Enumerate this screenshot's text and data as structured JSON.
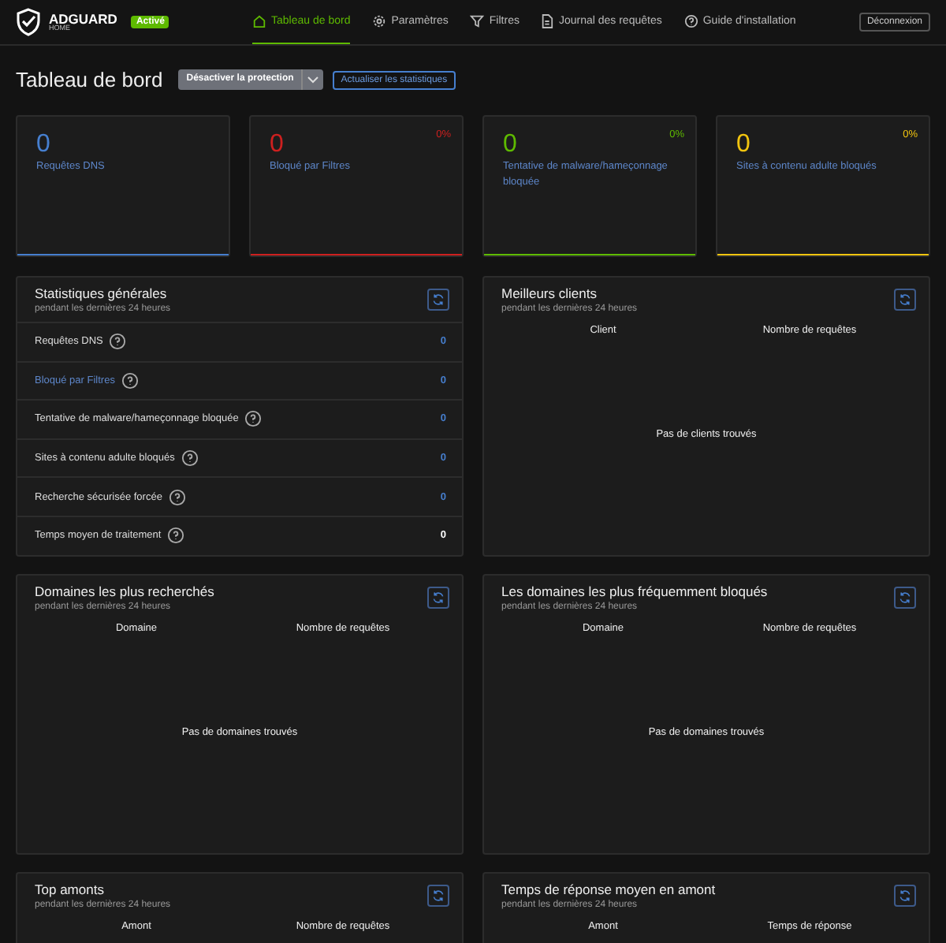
{
  "header": {
    "logo_title": "ADGUARD",
    "logo_subtitle": "HOME",
    "status_badge": "Activé",
    "nav": [
      {
        "label": "Tableau de bord",
        "kind": "home",
        "selected": true
      },
      {
        "label": "Paramètres",
        "kind": "settings",
        "selected": false
      },
      {
        "label": "Filtres",
        "kind": "filters",
        "selected": false
      },
      {
        "label": "Journal des requêtes",
        "kind": "log",
        "selected": false
      },
      {
        "label": "Guide d'installation",
        "kind": "guide",
        "selected": false
      }
    ],
    "logout_button": "Déconnexion"
  },
  "page": {
    "title": "Tableau de bord",
    "protection_button": "Désactiver la protection",
    "refresh_button": "Actualiser les statistiques"
  },
  "stat_cards": [
    {
      "value": "0",
      "label": "Requêtes DNS",
      "color": "#467fcf"
    },
    {
      "value": "0",
      "label": "Bloqué par Filtres",
      "percent": "0%",
      "color": "#cd201f"
    },
    {
      "value": "0",
      "label": "Tentative de malware/hameçonnage bloquée",
      "percent": "0%",
      "color": "#5eba00"
    },
    {
      "value": "0",
      "label": "Sites à contenu adulte bloqués",
      "percent": "0%",
      "color": "#f1c40f"
    }
  ],
  "general_stats": {
    "title": "Statistiques générales",
    "subtitle": "pendant les dernières 24 heures",
    "rows": [
      {
        "label": "Requêtes DNS",
        "value": "0",
        "label_link": false,
        "value_link": true
      },
      {
        "label": "Bloqué par Filtres",
        "value": "0",
        "label_link": true,
        "value_link": true
      },
      {
        "label": "Tentative de malware/hameçonnage bloquée",
        "value": "0",
        "label_link": false,
        "value_link": true
      },
      {
        "label": "Sites à contenu adulte bloqués",
        "value": "0",
        "label_link": false,
        "value_link": true
      },
      {
        "label": "Recherche sécurisée forcée",
        "value": "0",
        "label_link": false,
        "value_link": true
      },
      {
        "label": "Temps moyen de traitement",
        "value": "0",
        "label_link": false,
        "value_link": false
      }
    ]
  },
  "tables": [
    {
      "title": "Meilleurs clients",
      "subtitle": "pendant les dernières 24 heures",
      "columns": [
        "Client",
        "Nombre de requêtes"
      ],
      "empty_message": "Pas de clients trouvés"
    },
    {
      "title": "Domaines les plus recherchés",
      "subtitle": "pendant les dernières 24 heures",
      "columns": [
        "Domaine",
        "Nombre de requêtes"
      ],
      "empty_message": "Pas de domaines trouvés"
    },
    {
      "title": "Les domaines les plus fréquemment bloqués",
      "subtitle": "pendant les dernières 24 heures",
      "columns": [
        "Domaine",
        "Nombre de requêtes"
      ],
      "empty_message": "Pas de domaines trouvés"
    },
    {
      "title": "Top amonts",
      "subtitle": "pendant les dernières 24 heures",
      "columns": [
        "Amont",
        "Nombre de requêtes"
      ]
    },
    {
      "title": "Temps de réponse moyen en amont",
      "subtitle": "pendant les dernières 24 heures",
      "columns": [
        "Amont",
        "Temps de réponse"
      ]
    }
  ]
}
